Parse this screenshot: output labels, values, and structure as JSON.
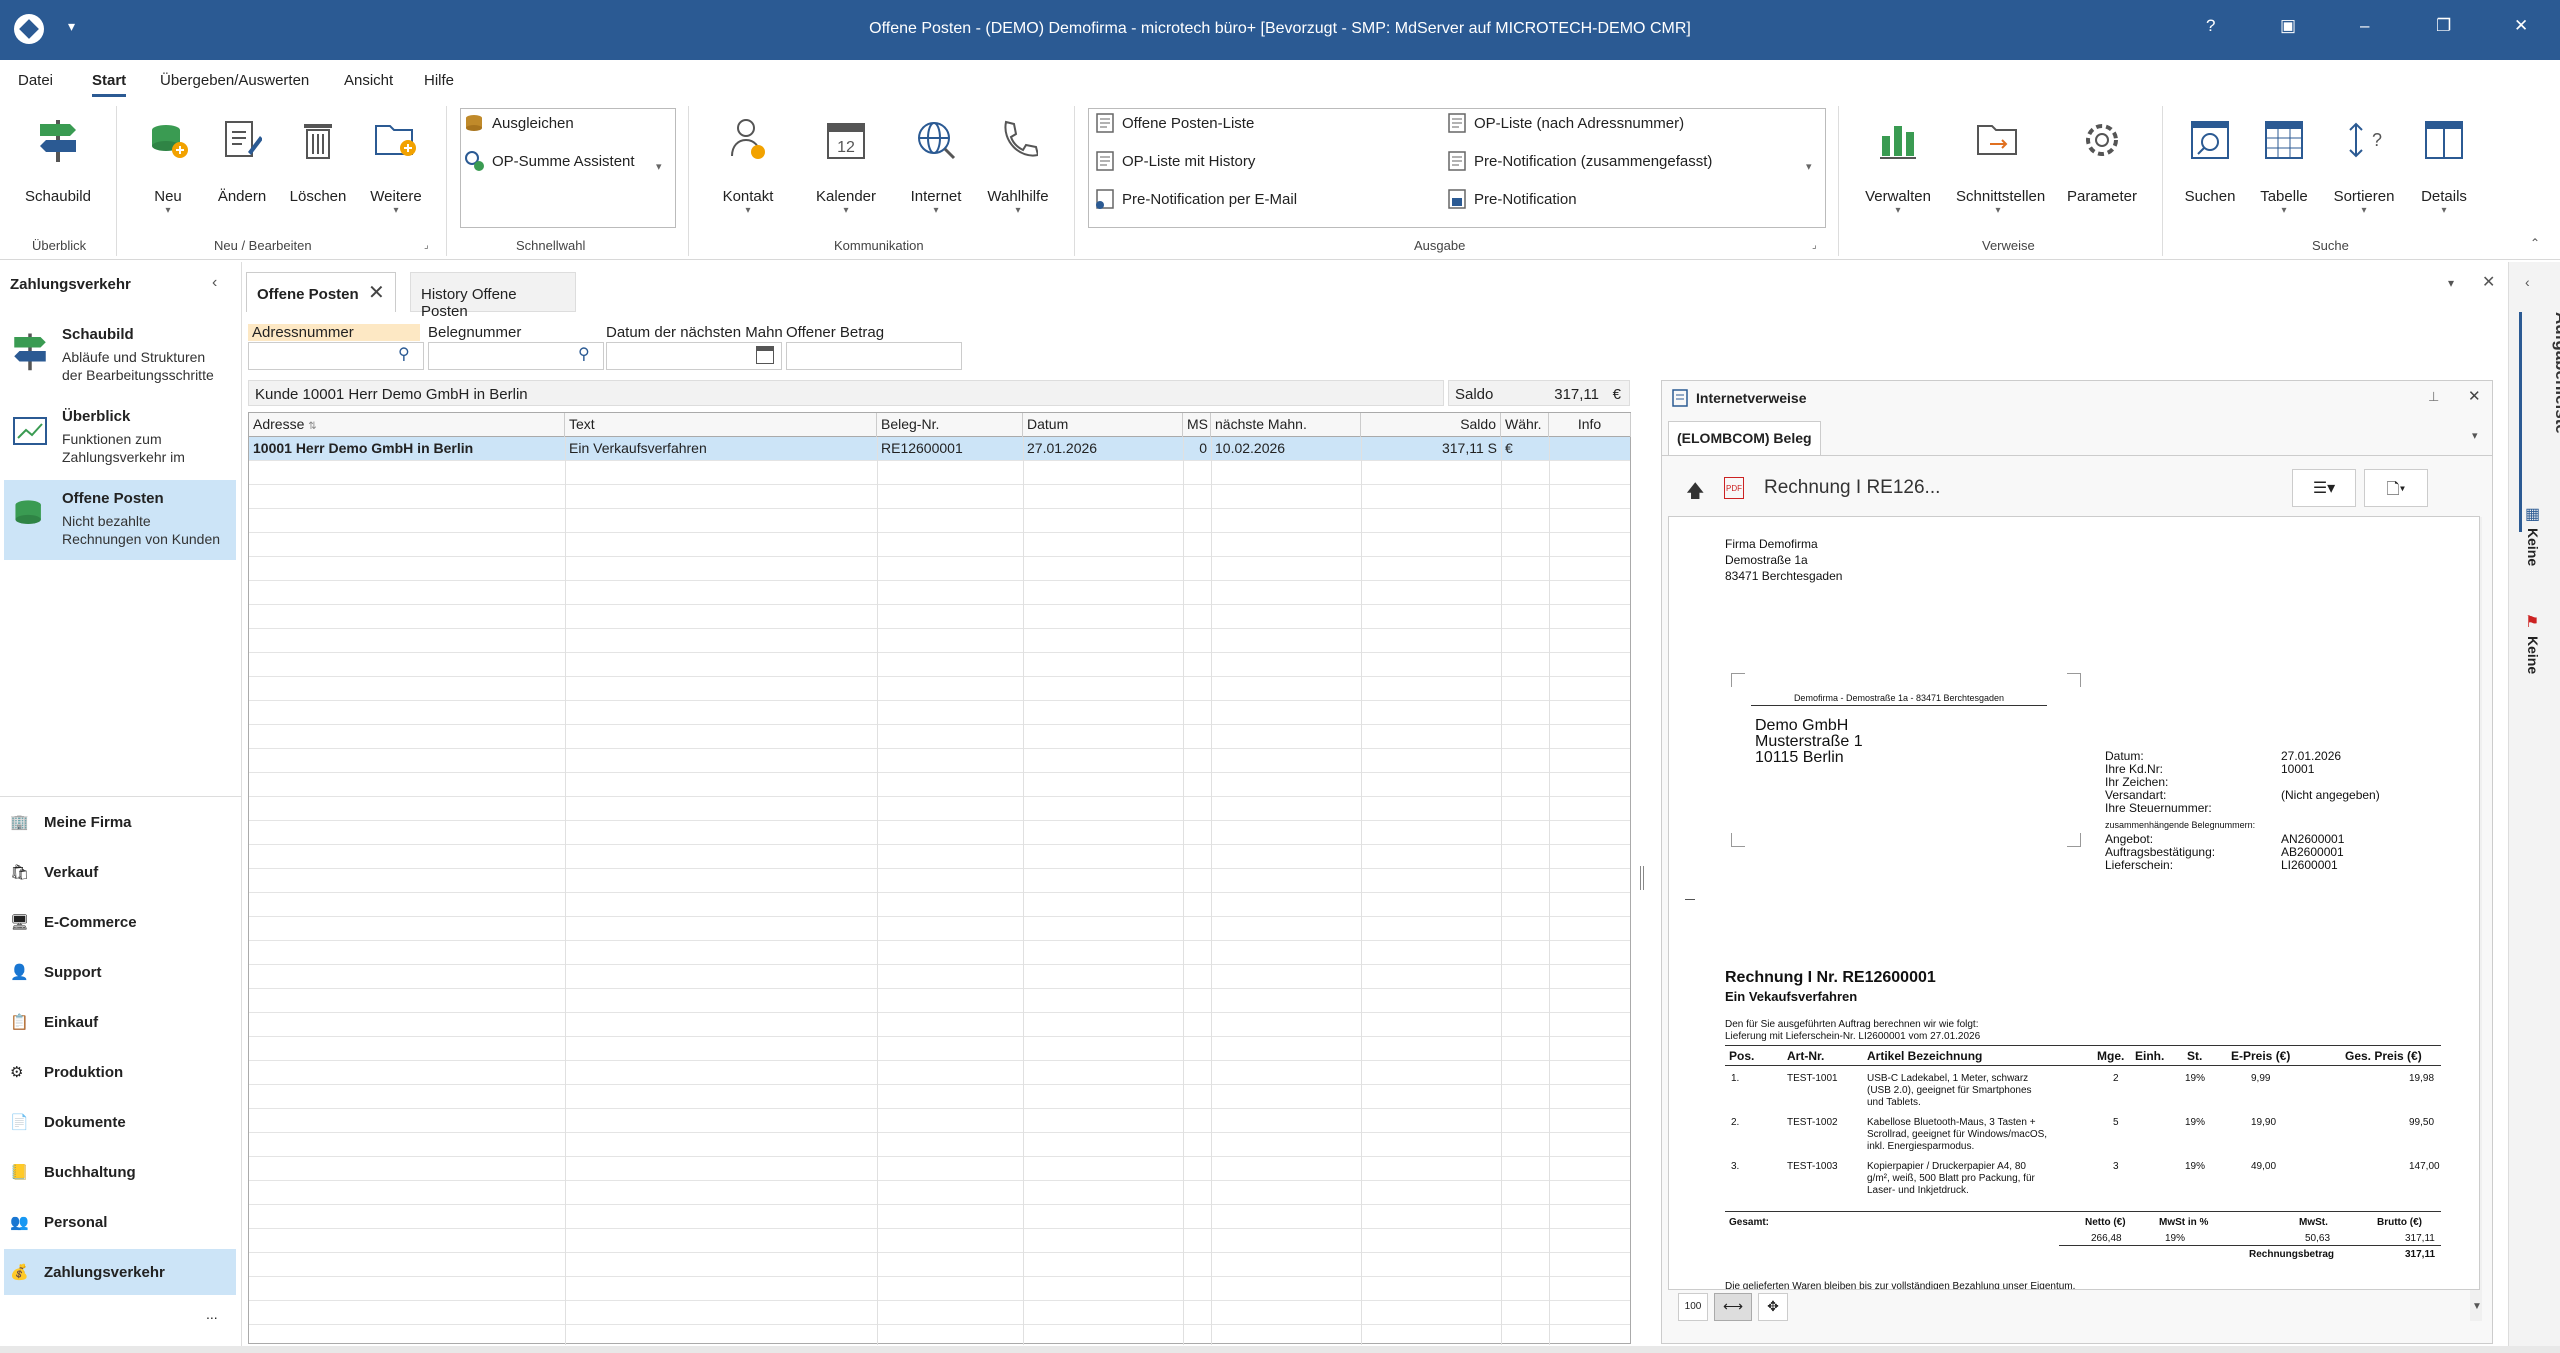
{
  "window": {
    "title": "Offene Posten - (DEMO) Demofirma - microtech büro+ [Bevorzugt - SMP: MdServer auf MICROTECH-DEMO CMR]"
  },
  "menu": [
    "Datei",
    "Start",
    "Übergeben/Auswerten",
    "Ansicht",
    "Hilfe"
  ],
  "ribbon": {
    "schaubild": "Schaubild",
    "ueberblick_grp": "Überblick",
    "neu": "Neu",
    "aendern": "Ändern",
    "loeschen": "Löschen",
    "weitere": "Weitere",
    "neu_grp": "Neu / Bearbeiten",
    "ausgleichen": "Ausgleichen",
    "op_summe": "OP-Summe Assistent",
    "schnellwahl_grp": "Schnellwahl",
    "kontakt": "Kontakt",
    "kalender": "Kalender",
    "internet": "Internet",
    "wahlhilfe": "Wahlhilfe",
    "kommunikation_grp": "Kommunikation",
    "ausgabe": [
      "Offene Posten-Liste",
      "OP-Liste mit History",
      "Pre-Notification per E-Mail",
      "OP-Liste (nach Adressnummer)",
      "Pre-Notification (zusammengefasst)",
      "Pre-Notification"
    ],
    "ausgabe_grp": "Ausgabe",
    "verwalten": "Verwalten",
    "schnittstellen": "Schnittstellen",
    "parameter": "Parameter",
    "verweise_grp": "Verweise",
    "suchen": "Suchen",
    "tabelle": "Tabelle",
    "sortieren": "Sortieren",
    "details": "Details",
    "suche_grp": "Suche"
  },
  "left": {
    "header": "Zahlungsverkehr",
    "items": [
      {
        "title": "Schaubild",
        "desc1": "Abläufe und Strukturen",
        "desc2": "der Bearbeitungsschritte"
      },
      {
        "title": "Überblick",
        "desc1": "Funktionen zum",
        "desc2": "Zahlungsverkehr im"
      },
      {
        "title": "Offene Posten",
        "desc1": "Nicht bezahlte",
        "desc2": "Rechnungen von Kunden"
      }
    ],
    "modules": [
      "Meine Firma",
      "Verkauf",
      "E-Commerce",
      "Support",
      "Einkauf",
      "Produktion",
      "Dokumente",
      "Buchhaltung",
      "Personal",
      "Zahlungsverkehr"
    ],
    "more": "..."
  },
  "tabs": [
    "Offene Posten",
    "History Offene Posten"
  ],
  "filters": {
    "adressnummer": "Adressnummer",
    "belegnummer": "Belegnummer",
    "datum": "Datum der nächsten Mahn",
    "betrag": "Offener Betrag"
  },
  "info": {
    "kunde": "Kunde 10001 Herr Demo GmbH in Berlin",
    "saldo_label": "Saldo",
    "saldo_value": "317,11",
    "currency": "€"
  },
  "grid": {
    "headers": [
      "Adresse",
      "Text",
      "Beleg-Nr.",
      "Datum",
      "MS",
      "nächste Mahn.",
      "Saldo",
      "Währ.",
      "Info"
    ],
    "rows": [
      [
        "10001 Herr Demo GmbH in Berlin",
        "Ein Verkaufsverfahren",
        "RE12600001",
        "27.01.2026",
        "0",
        "10.02.2026",
        "317,11 S",
        "€",
        ""
      ]
    ]
  },
  "iv": {
    "title": "Internetverweise",
    "tab": "(ELOMBCOM) Beleg",
    "doc_title": "Rechnung I RE126..."
  },
  "doc": {
    "sender": [
      "Firma Demofirma",
      "Demostraße 1a",
      "83471 Berchtesgaden"
    ],
    "sender_line": "Demofirma - Demostraße 1a - 83471 Berchtesgaden",
    "recipient": [
      "Demo GmbH",
      "Musterstraße 1",
      "10115 Berlin"
    ],
    "meta_labels": [
      "Datum:",
      "Ihre Kd.Nr:",
      "Ihr Zeichen:",
      "Versandart:",
      "Ihre Steuernummer:"
    ],
    "meta_values": [
      "27.01.2026",
      "10001",
      "",
      "(Nicht angegeben)",
      ""
    ],
    "rel_title": "zusammenhängende Belegnummern:",
    "rel_labels": [
      "Angebot:",
      "Auftragsbestätigung:",
      "Lieferschein:"
    ],
    "rel_values": [
      "AN2600001",
      "AB2600001",
      "LI2600001"
    ],
    "heading": "Rechnung I Nr. RE12600001",
    "subheading": "Ein Vekaufsverfahren",
    "intro1": "Den für Sie ausgeführten Auftrag berechnen wir wie folgt:",
    "intro2": "Lieferung mit Lieferschein-Nr. LI2600001 vom 27.01.2026",
    "cols": [
      "Pos.",
      "Art-Nr.",
      "Artikel Bezeichnung",
      "Mge.",
      "Einh.",
      "St.",
      "E-Preis (€)",
      "Ges. Preis (€)"
    ],
    "lines": [
      {
        "pos": "1.",
        "art": "TEST-1001",
        "d1": "USB-C Ladekabel, 1 Meter, schwarz",
        "d2": "(USB 2.0), geeignet für Smartphones",
        "d3": "und Tablets.",
        "mge": "2",
        "st": "19%",
        "ep": "9,99",
        "gp": "19,98"
      },
      {
        "pos": "2.",
        "art": "TEST-1002",
        "d1": "Kabellose Bluetooth-Maus, 3 Tasten +",
        "d2": "Scrollrad, geeignet für Windows/macOS,",
        "d3": "inkl. Energiesparmodus.",
        "mge": "5",
        "st": "19%",
        "ep": "19,90",
        "gp": "99,50"
      },
      {
        "pos": "3.",
        "art": "TEST-1003",
        "d1": "Kopierpapier / Druckerpapier A4, 80",
        "d2": "g/m², weiß, 500 Blatt pro Packung, für",
        "d3": "Laser- und Inkjetdruck.",
        "mge": "3",
        "st": "19%",
        "ep": "49,00",
        "gp": "147,00"
      }
    ],
    "totals": {
      "gesamt": "Gesamt:",
      "netto_l": "Netto (€)",
      "mwst_pct_l": "MwSt in %",
      "mwst_l": "MwSt.",
      "brutto_l": "Brutto (€)",
      "netto": "266,48",
      "mwst_pct": "19%",
      "mwst": "50,63",
      "brutto": "317,11",
      "rb_l": "Rechnungsbetrag",
      "rb": "317,11"
    },
    "footer": "Die gelieferten Waren bleiben bis zur vollständigen Bezahlung unser Eigentum."
  },
  "rightbar": {
    "aufgaben": "Aufgabenleiste",
    "keine1": "Keine",
    "keine2": "Keine"
  },
  "colors": {
    "accent": "#2b5a93",
    "selection": "#cce4f7",
    "green": "#3a9b52"
  }
}
